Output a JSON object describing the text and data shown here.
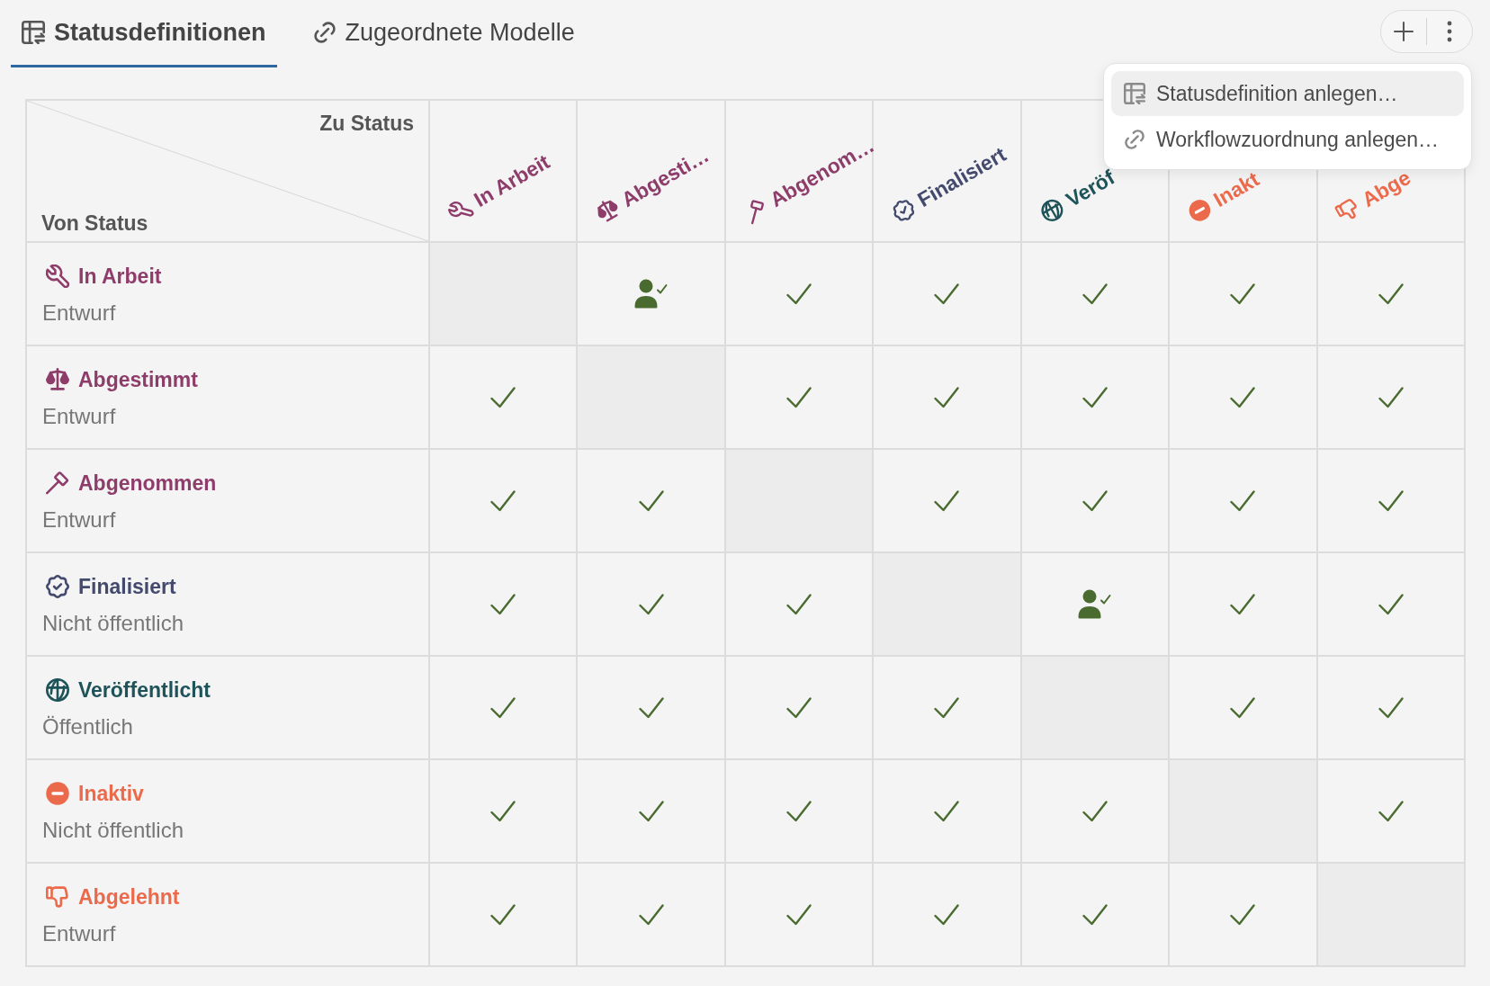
{
  "tabs": [
    {
      "label": "Statusdefinitionen",
      "selected": true
    },
    {
      "label": "Zugeordnete Modelle",
      "selected": false
    }
  ],
  "menu": {
    "items": [
      {
        "label": "Statusdefinition anlegen…",
        "highlighted": true
      },
      {
        "label": "Workflowzuordnung anlegen…",
        "highlighted": false
      }
    ]
  },
  "matrix": {
    "corner": {
      "to_label": "Zu Status",
      "from_label": "Von Status"
    },
    "columns": [
      {
        "label": "In Arbeit",
        "color": "#8e3d6b"
      },
      {
        "label": "Abgesti…",
        "color": "#8e3d6b"
      },
      {
        "label": "Abgenom…",
        "color": "#8e3d6b"
      },
      {
        "label": "Finalisiert",
        "color": "#434a6e"
      },
      {
        "label": "Veröf",
        "color": "#1e5359"
      },
      {
        "label": "Inakt",
        "color": "#ec6a4c"
      },
      {
        "label": "Abge",
        "color": "#ec6a4c"
      }
    ],
    "rows": [
      {
        "title": "In Arbeit",
        "subtitle": "Entwurf",
        "color": "#8e3d6b",
        "cells": [
          {
            "kind": "self"
          },
          {
            "kind": "approval"
          },
          {
            "kind": "allowed"
          },
          {
            "kind": "allowed"
          },
          {
            "kind": "allowed"
          },
          {
            "kind": "allowed"
          },
          {
            "kind": "allowed"
          }
        ]
      },
      {
        "title": "Abgestimmt",
        "subtitle": "Entwurf",
        "color": "#8e3d6b",
        "cells": [
          {
            "kind": "allowed"
          },
          {
            "kind": "self"
          },
          {
            "kind": "allowed"
          },
          {
            "kind": "allowed"
          },
          {
            "kind": "allowed"
          },
          {
            "kind": "allowed"
          },
          {
            "kind": "allowed"
          }
        ]
      },
      {
        "title": "Abgenommen",
        "subtitle": "Entwurf",
        "color": "#8e3d6b",
        "cells": [
          {
            "kind": "allowed"
          },
          {
            "kind": "allowed"
          },
          {
            "kind": "self"
          },
          {
            "kind": "allowed"
          },
          {
            "kind": "allowed"
          },
          {
            "kind": "allowed"
          },
          {
            "kind": "allowed"
          }
        ]
      },
      {
        "title": "Finalisiert",
        "subtitle": "Nicht öffentlich",
        "color": "#434a6e",
        "cells": [
          {
            "kind": "allowed"
          },
          {
            "kind": "allowed"
          },
          {
            "kind": "allowed"
          },
          {
            "kind": "self"
          },
          {
            "kind": "approval"
          },
          {
            "kind": "allowed"
          },
          {
            "kind": "allowed"
          }
        ]
      },
      {
        "title": "Veröffentlicht",
        "subtitle": "Öffentlich",
        "color": "#1e5359",
        "cells": [
          {
            "kind": "allowed"
          },
          {
            "kind": "allowed"
          },
          {
            "kind": "allowed"
          },
          {
            "kind": "allowed"
          },
          {
            "kind": "self"
          },
          {
            "kind": "allowed"
          },
          {
            "kind": "allowed"
          }
        ]
      },
      {
        "title": "Inaktiv",
        "subtitle": "Nicht öffentlich",
        "color": "#ec6a4c",
        "cells": [
          {
            "kind": "allowed"
          },
          {
            "kind": "allowed"
          },
          {
            "kind": "allowed"
          },
          {
            "kind": "allowed"
          },
          {
            "kind": "allowed"
          },
          {
            "kind": "self"
          },
          {
            "kind": "allowed"
          }
        ]
      },
      {
        "title": "Abgelehnt",
        "subtitle": "Entwurf",
        "color": "#ec6a4c",
        "cells": [
          {
            "kind": "allowed"
          },
          {
            "kind": "allowed"
          },
          {
            "kind": "allowed"
          },
          {
            "kind": "allowed"
          },
          {
            "kind": "allowed"
          },
          {
            "kind": "allowed"
          },
          {
            "kind": "self"
          }
        ]
      }
    ]
  }
}
